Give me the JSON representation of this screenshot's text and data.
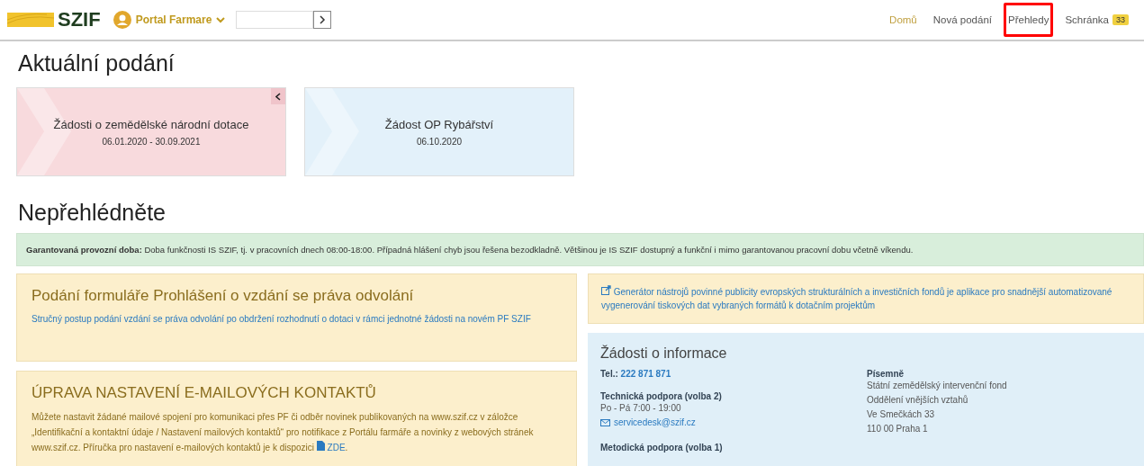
{
  "header": {
    "logo": "SZIF",
    "portal": "Portal Farmare",
    "nav": [
      {
        "label": "Domů",
        "selected": true,
        "highlighted": false
      },
      {
        "label": "Nová podání",
        "selected": false,
        "highlighted": false
      },
      {
        "label": "Přehledy",
        "selected": false,
        "highlighted": true
      },
      {
        "label": "Schránka",
        "selected": false,
        "highlighted": false,
        "badge": "33"
      }
    ]
  },
  "current": {
    "title": "Aktuální podání",
    "cards": [
      {
        "title": "Žádosti o zemědělské národní dotace",
        "dates": "06.01.2020 - 30.09.2021",
        "color": "#f8dadd",
        "collapsible": true
      },
      {
        "title": "Žádost OP Rybářství",
        "dates": "06.10.2020",
        "color": "#e3f1fa",
        "collapsible": false
      }
    ]
  },
  "notice": {
    "title": "Nepřehlédněte",
    "banner": "**Garantovaná provozní doba:** Doba funkčnosti IS SZIF, tj. v pracovních dnech 08:00-18:00. Případná hlášení chyb jsou řešena bezodkladně. Většinou je IS SZIF dostupný a funkční i mimo garantovanou pracovní dobu včetně víkendu.",
    "left": [
      {
        "title": "Podání formuláře Prohlášení o vzdání se práva odvolání",
        "link": "Stručný postup podání vzdání se práva odvolání po obdržení rozhodnutí o dotaci v rámci jednotné žádosti na novém PF SZIF"
      },
      {
        "title": "ÚPRAVA NASTAVENÍ E-MAILOVÝCH KONTAKTŮ",
        "text": "Můžete nastavit žádané mailové spojení pro komunikaci přes PF či odběr novinek publikovaných na www.szif.cz v záložce „Identifikační a kontaktní údaje / Nastavení mailových kontaktů“ pro notifikace z Portálu farmáře a novinky z webových stránek www.szif.cz. Příručka pro nastavení e-mailových kontaktů je k dispozici",
        "file_link": "ZDE",
        "tail": "."
      }
    ],
    "generator": "Generátor nástrojů povinné publicity evropských strukturálních a investičních fondů je aplikace pro snadnější automatizované vygenerování tiskových dat vybraných formátů k dotačním projektům",
    "info": {
      "title": "Žádosti o informace",
      "tel_label": "Tel.:",
      "tel": "222 871 871",
      "tech_label": "Technická podpora (volba 2)",
      "tech_hours": "Po - Pá 7:00 - 19:00",
      "email": "servicedesk@szif.cz",
      "method_label": "Metodická podpora (volba 1)",
      "written_label": "Písemně",
      "address": [
        "Státní zemědělský intervenční fond",
        "Oddělení vnějších vztahů",
        "Ve Smečkách 33",
        "110 00 Praha 1"
      ]
    }
  }
}
